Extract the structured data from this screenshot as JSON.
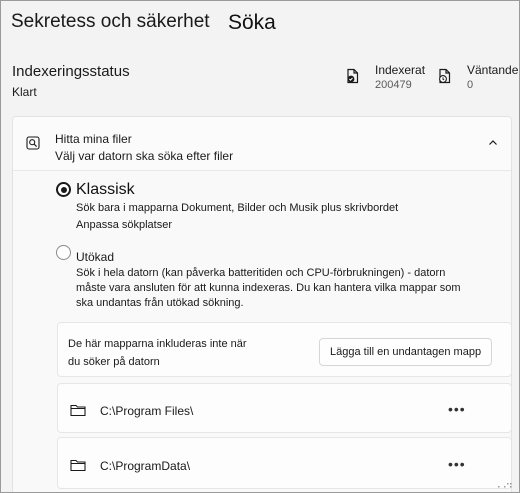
{
  "header": {
    "breadcrumb_parent": "Sekretess och säkerhet",
    "current_page": "Söka"
  },
  "status": {
    "title": "Indexeringsstatus",
    "value": "Klart",
    "indexed_label": "Indexerat",
    "indexed_count": "200479",
    "pending_label": "Väntande",
    "pending_count": "0"
  },
  "find_files": {
    "title": "Hitta mina filer",
    "subtitle": "Välj var datorn ska söka efter filer",
    "classic": {
      "title": "Klassisk",
      "description": "Sök bara i mapparna Dokument, Bilder och Musik plus skrivbordet",
      "link": "Anpassa sökplatser",
      "selected": true
    },
    "enhanced": {
      "title": "Utökad",
      "description_lines": [
        "Sök i hela datorn (kan påverka batteritiden och CPU-förbrukningen) - datorn",
        "måste vara ansluten för att kunna indexeras. Du kan hantera vilka mappar som",
        "ska undantas från utökad sökning."
      ],
      "selected": false
    },
    "exclusions": {
      "text_lines": [
        "De här mapparna inkluderas inte när",
        "du söker på datorn"
      ],
      "add_button": "Lägga till en undantagen mapp"
    },
    "excluded_folders": [
      {
        "path": "C:\\Program Files\\",
        "more": "•••"
      },
      {
        "path": "C:\\ProgramData\\",
        "more": "•••"
      }
    ]
  },
  "icons": {
    "indexed": "indexed-file-icon",
    "pending": "pending-file-icon",
    "search": "search-icon",
    "chevron": "chevron-up-icon",
    "folder": "folder-icon",
    "more": "more-options-icon"
  }
}
